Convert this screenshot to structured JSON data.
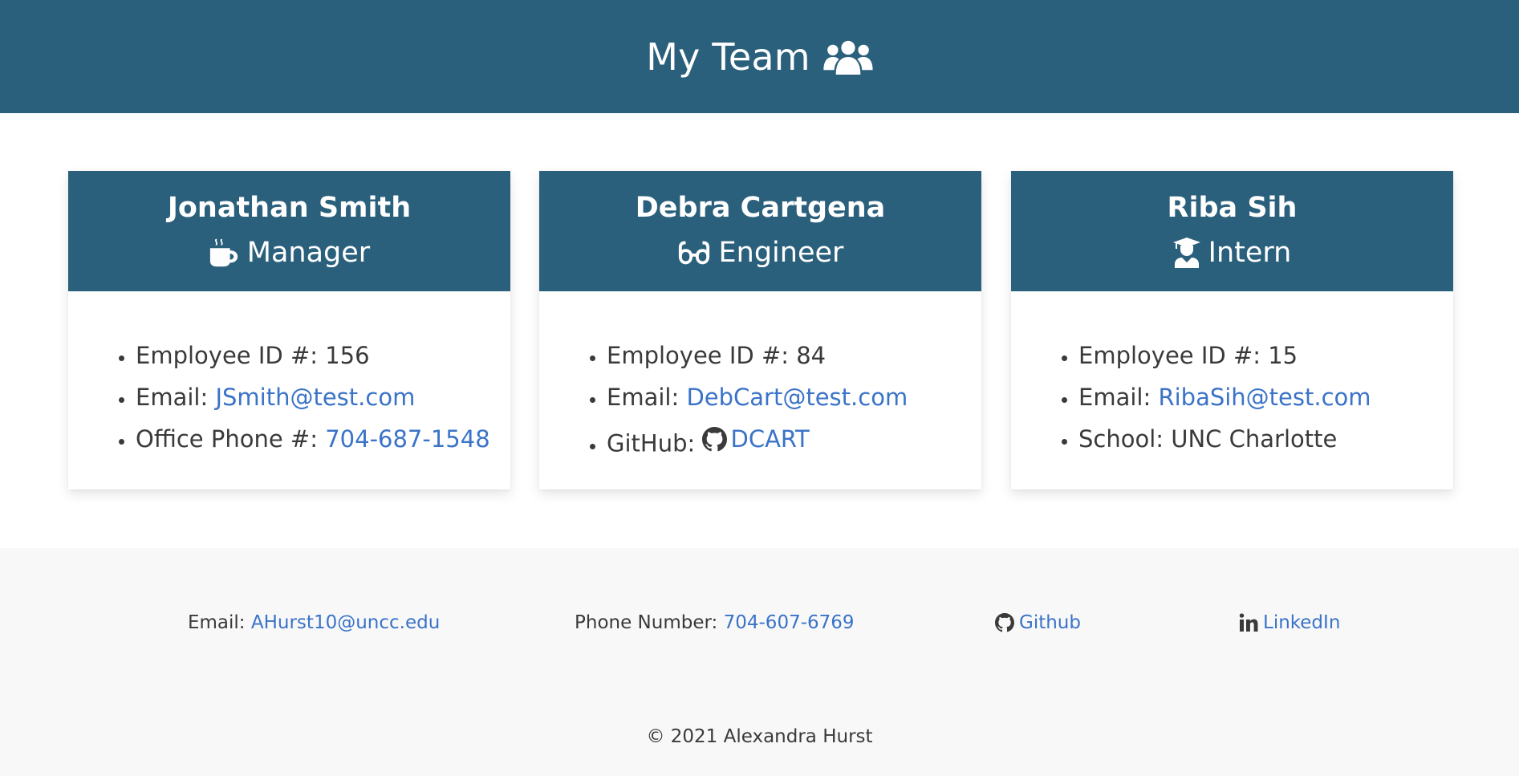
{
  "header": {
    "title": "My Team",
    "icon": "users-icon"
  },
  "cards": [
    {
      "name": "Jonathan Smith",
      "role": "Manager",
      "role_icon": "coffee-mug-icon",
      "items": [
        {
          "label": "Employee ID #: ",
          "value": "156"
        },
        {
          "label": "Email: ",
          "link": "JSmith@test.com"
        },
        {
          "label": "Office Phone #: ",
          "link": "704-687-1548"
        }
      ]
    },
    {
      "name": "Debra Cartgena",
      "role": "Engineer",
      "role_icon": "glasses-icon",
      "items": [
        {
          "label": "Employee ID #: ",
          "value": "84"
        },
        {
          "label": "Email: ",
          "link": "DebCart@test.com"
        },
        {
          "label": "GitHub: ",
          "link": "DCART",
          "icon": "github-icon"
        }
      ]
    },
    {
      "name": "Riba Sih",
      "role": "Intern",
      "role_icon": "graduate-icon",
      "items": [
        {
          "label": "Employee ID #: ",
          "value": "15"
        },
        {
          "label": "Email: ",
          "link": "RibaSih@test.com"
        },
        {
          "label": "School: ",
          "value": "UNC Charlotte"
        }
      ]
    }
  ],
  "footer": {
    "email_label": "Email: ",
    "email": "AHurst10@uncc.edu",
    "phone_label": "Phone Number: ",
    "phone": "704-607-6769",
    "github": "Github",
    "linkedin": "LinkedIn",
    "copyright": "© 2021 Alexandra Hurst"
  },
  "colors": {
    "header": "#2b607c",
    "link": "#3a73c8",
    "footer_bg": "#f8f8f8"
  }
}
